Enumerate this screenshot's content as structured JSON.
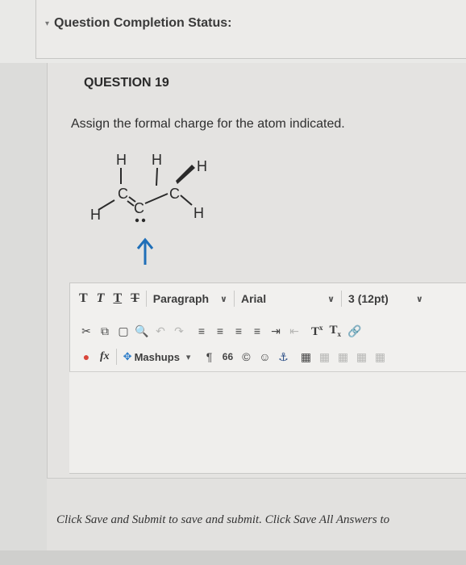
{
  "status": {
    "title": "Question Completion Status:"
  },
  "question": {
    "header": "QUESTION 19",
    "prompt": "Assign the formal charge for the atom indicated."
  },
  "molecule": {
    "atoms": {
      "h": "H",
      "c": "C"
    }
  },
  "editor": {
    "format_buttons": [
      "T",
      "T",
      "T",
      "T"
    ],
    "paragraph": "Paragraph",
    "font": "Arial",
    "size": "3 (12pt)",
    "mashups": "Mashups",
    "superscript": "T",
    "subscript": "T",
    "fx": "fx",
    "quote": "66"
  },
  "footer": {
    "instructions": "Click Save and Submit to save and submit. Click Save All Answers to"
  },
  "colors": {
    "arrow": "#1f6fb8",
    "spellcheck": "#d9463a"
  }
}
